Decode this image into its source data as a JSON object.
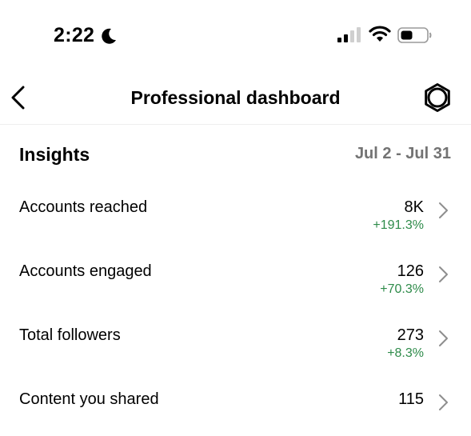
{
  "status_bar": {
    "time": "2:22",
    "icons": [
      "moon-icon",
      "signal-icon",
      "wifi-icon",
      "battery-icon"
    ]
  },
  "header": {
    "title": "Professional dashboard",
    "back_icon": "chevron-left-icon",
    "settings_icon": "gear-icon"
  },
  "insights": {
    "title": "Insights",
    "date_range": "Jul 2 - Jul 31",
    "rows": [
      {
        "label": "Accounts reached",
        "value": "8K",
        "change": "+191.3%"
      },
      {
        "label": "Accounts engaged",
        "value": "126",
        "change": "+70.3%"
      },
      {
        "label": "Total followers",
        "value": "273",
        "change": "+8.3%"
      },
      {
        "label": "Content you shared",
        "value": "115",
        "change": ""
      }
    ]
  },
  "colors": {
    "positive_change": "#2e8b4a",
    "muted_text": "#737373",
    "chevron": "#8e8e8e"
  }
}
